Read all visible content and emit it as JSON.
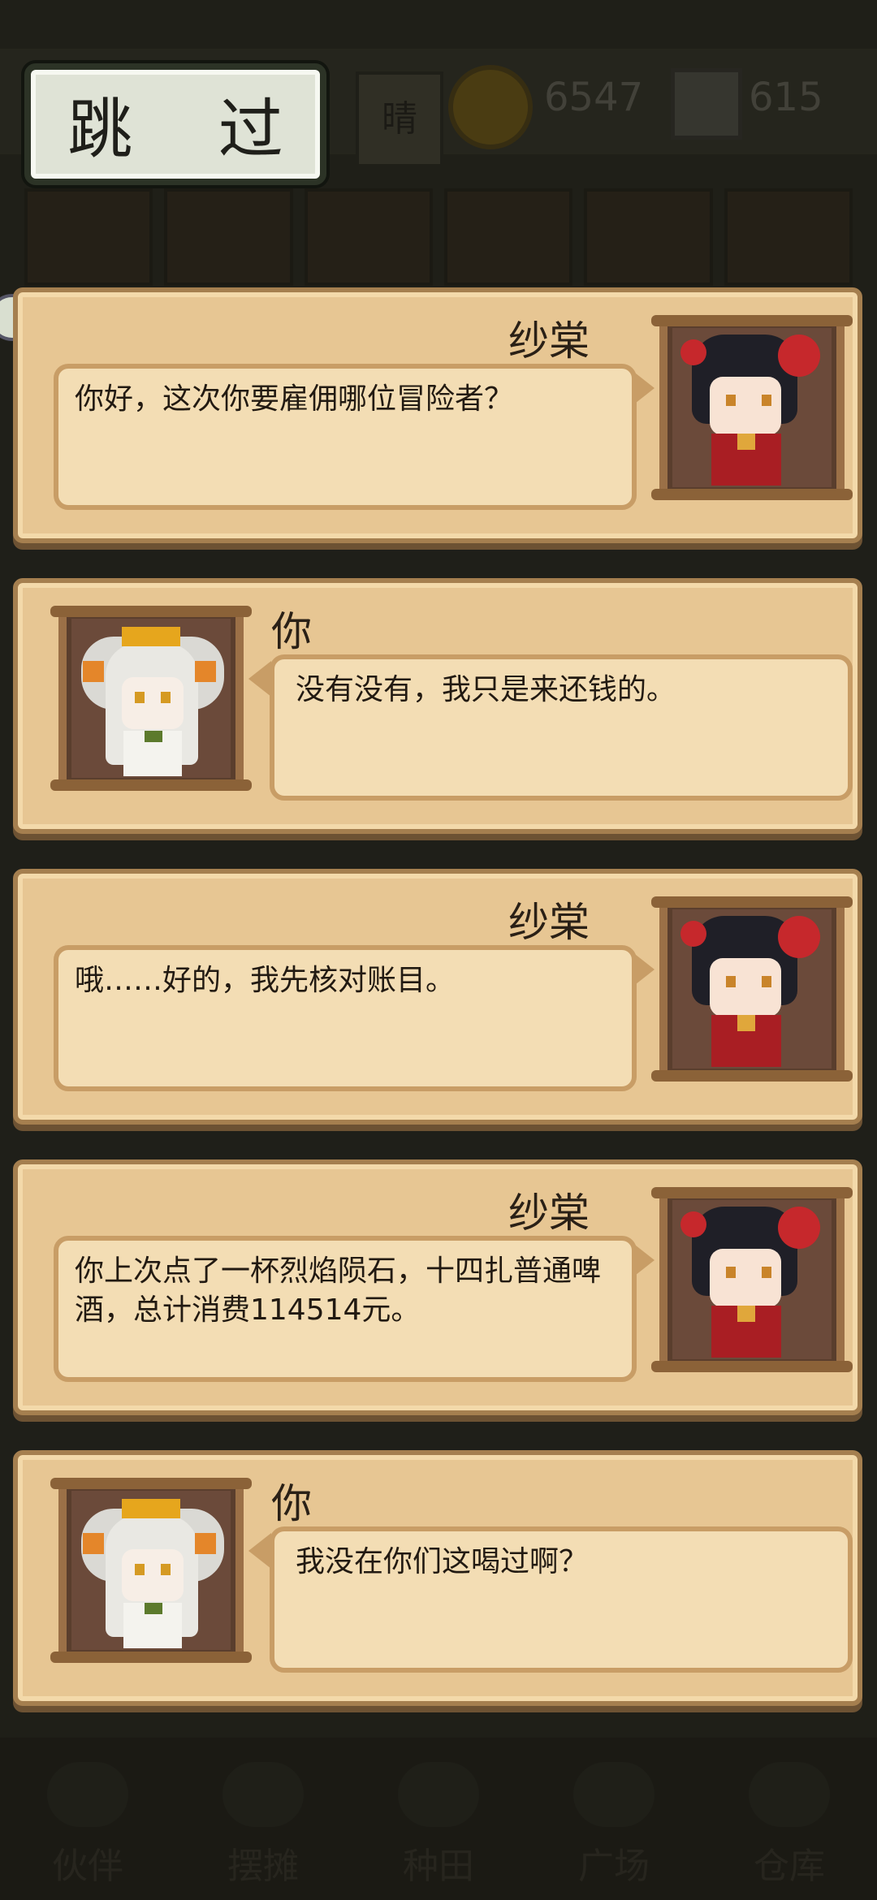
{
  "skip_button": {
    "label": "跳 过"
  },
  "background": {
    "weather": "晴",
    "money": "6547",
    "gems": "615",
    "nav_items": [
      "伙伴",
      "摆摊",
      "种田",
      "广场",
      "仓库"
    ]
  },
  "dialogues": [
    {
      "speaker": "纱棠",
      "side": "right",
      "text": "你好，这次你要雇佣哪位冒险者？"
    },
    {
      "speaker": "你",
      "side": "left",
      "text": "没有没有，我只是来还钱的。"
    },
    {
      "speaker": "纱棠",
      "side": "right",
      "text": "哦……好的，我先核对账目。"
    },
    {
      "speaker": "纱棠",
      "side": "right",
      "text": "你上次点了一杯烈焰陨石，十四扎普通啤酒，总计消费114514元。"
    },
    {
      "speaker": "你",
      "side": "left",
      "text": "我没在你们这喝过啊？"
    }
  ],
  "icons": {
    "skip": "skip-button",
    "coin": "coin-icon",
    "gem": "gem-icon"
  }
}
